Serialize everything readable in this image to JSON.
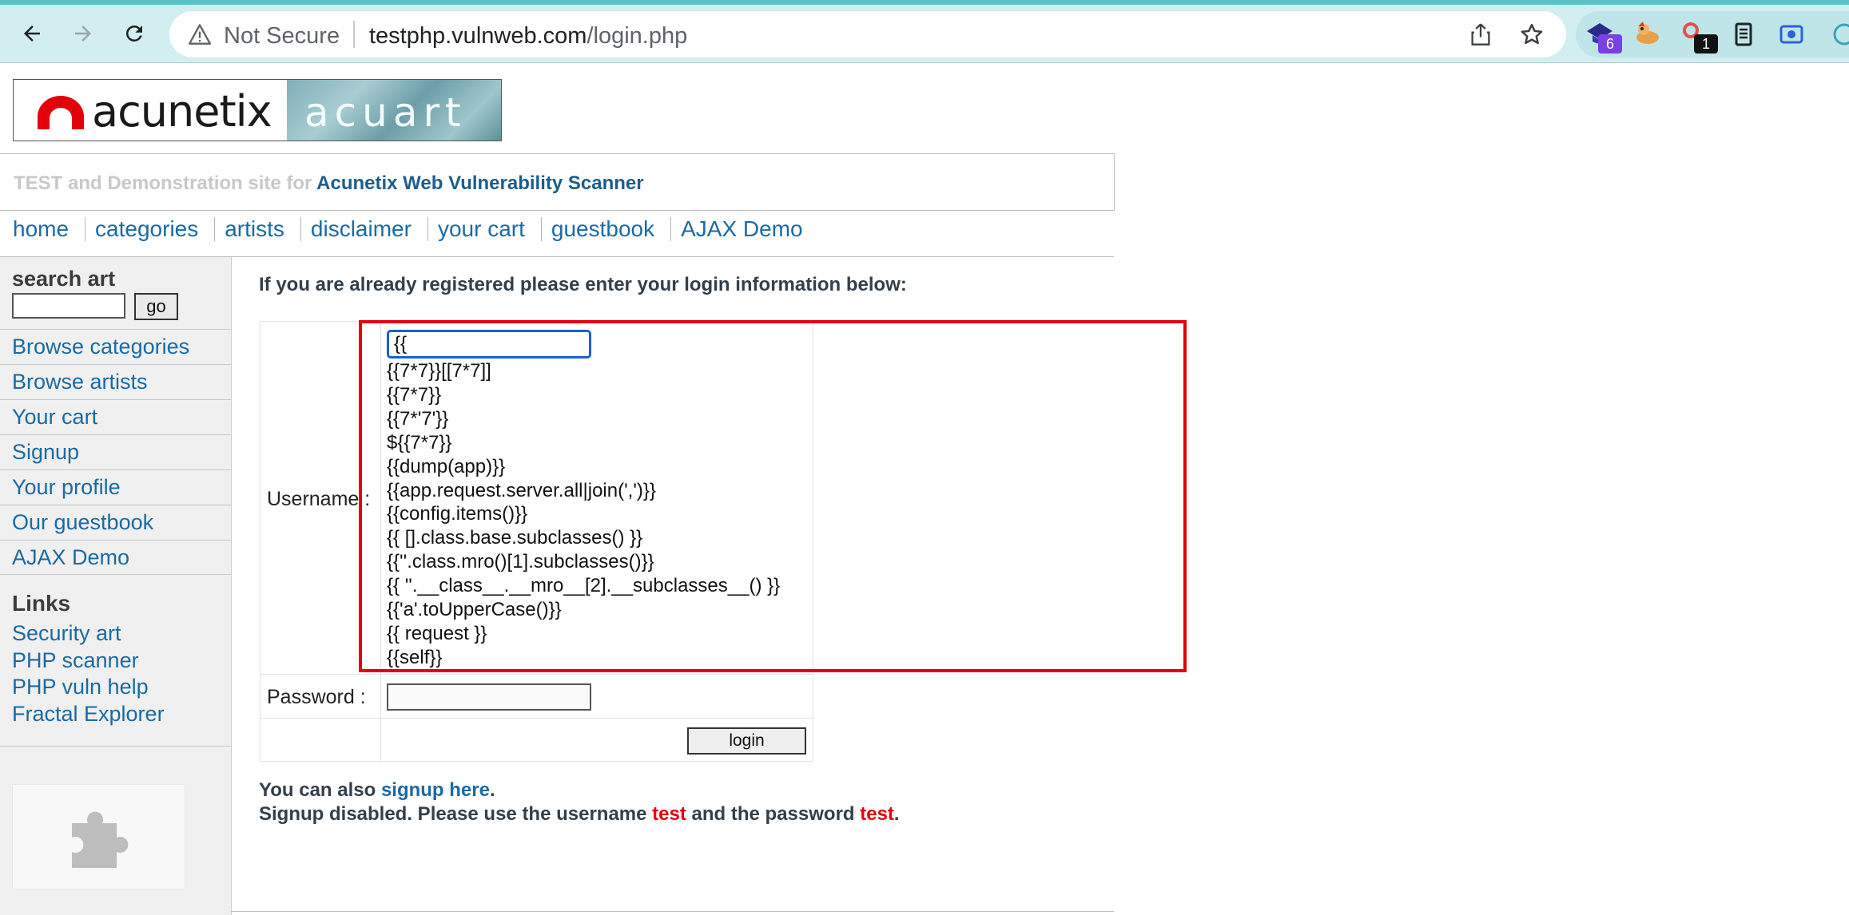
{
  "browser": {
    "not_secure": "Not Secure",
    "url_host": "testphp.vulnweb.com",
    "url_path": "/login.php",
    "extensions": [
      {
        "name": "extension-graduation-cap",
        "badge": "6",
        "badge_color": "#7b3fe4"
      },
      {
        "name": "extension-dragon",
        "badge": ""
      },
      {
        "name": "extension-key",
        "badge": "1",
        "badge_color": "#111111"
      },
      {
        "name": "extension-reader",
        "badge": ""
      },
      {
        "name": "extension-screen-record",
        "badge": ""
      }
    ],
    "toolbar_color": "#d2eef1"
  },
  "site": {
    "logo_left": "acunetix",
    "logo_right": "acuart",
    "tagline_grey": "TEST and Demonstration site for ",
    "tagline_blue": "Acunetix Web Vulnerability Scanner",
    "nav": [
      "home",
      "categories",
      "artists",
      "disclaimer",
      "your cart",
      "guestbook",
      "AJAX Demo"
    ]
  },
  "sidebar": {
    "search_label": "search art",
    "search_value": "",
    "go_label": "go",
    "items": [
      "Browse categories",
      "Browse artists",
      "Your cart",
      "Signup",
      "Your profile",
      "Our guestbook",
      "AJAX Demo"
    ],
    "links_title": "Links",
    "links": [
      "Security art",
      "PHP scanner",
      "PHP vuln help",
      "Fractal Explorer"
    ]
  },
  "main": {
    "intro": "If you are already registered please enter your login information below:",
    "username_label": "Username :",
    "username_value": "{{",
    "password_label": "Password :",
    "login_label": "login",
    "suggestions": [
      "{{7*7}}[[7*7]]",
      "{{7*7}}",
      "{{7*'7'}}",
      "${{7*7}}",
      "{{dump(app)}}",
      "{{app.request.server.all|join(',')}}",
      "{{config.items()}}",
      "{{ [].class.base.subclasses() }}",
      "{{''.class.mro()[1].subclasses()}}",
      "{{ ''.__class__.__mro__[2].__subclasses__() }}",
      "{{'a'.toUpperCase()}}",
      "{{ request }}",
      "{{self}}"
    ],
    "signup_prefix": "You can also ",
    "signup_link": "signup here",
    "signup_suffix": ".",
    "disabled_prefix": "Signup disabled. Please use the username ",
    "disabled_user": "test",
    "disabled_middle": " and the password ",
    "disabled_pass": "test",
    "disabled_suffix": "."
  },
  "colors": {
    "link_blue": "#1a6aa4",
    "highlight_red": "#e3000b",
    "focus_blue": "#1a5fd6"
  }
}
